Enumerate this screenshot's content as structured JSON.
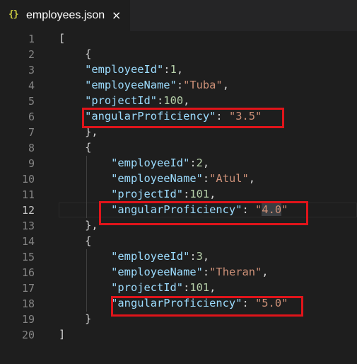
{
  "tab": {
    "icon": "{}",
    "label": "employees.json",
    "close": "×"
  },
  "editor": {
    "active_line": 12,
    "lines": [
      {
        "num": "1",
        "tokens": [
          {
            "t": "[",
            "c": "punc"
          }
        ]
      },
      {
        "num": "2",
        "tokens": [
          {
            "t": "    {",
            "c": "punc"
          }
        ]
      },
      {
        "num": "3",
        "tokens": [
          {
            "t": "    ",
            "c": "punc"
          },
          {
            "t": "\"employeeId\"",
            "c": "key"
          },
          {
            "t": ":",
            "c": "punc"
          },
          {
            "t": "1",
            "c": "num"
          },
          {
            "t": ",",
            "c": "punc"
          }
        ]
      },
      {
        "num": "4",
        "tokens": [
          {
            "t": "    ",
            "c": "punc"
          },
          {
            "t": "\"employeeName\"",
            "c": "key"
          },
          {
            "t": ":",
            "c": "punc"
          },
          {
            "t": "\"Tuba\"",
            "c": "str"
          },
          {
            "t": ",",
            "c": "punc"
          }
        ]
      },
      {
        "num": "5",
        "tokens": [
          {
            "t": "    ",
            "c": "punc"
          },
          {
            "t": "\"projectId\"",
            "c": "key"
          },
          {
            "t": ":",
            "c": "punc"
          },
          {
            "t": "100",
            "c": "num"
          },
          {
            "t": ",",
            "c": "punc"
          }
        ]
      },
      {
        "num": "6",
        "tokens": [
          {
            "t": "    ",
            "c": "punc"
          },
          {
            "t": "\"angularProficiency\"",
            "c": "key"
          },
          {
            "t": ": ",
            "c": "punc"
          },
          {
            "t": "\"3.5\"",
            "c": "str"
          }
        ]
      },
      {
        "num": "7",
        "tokens": [
          {
            "t": "    },",
            "c": "punc"
          }
        ]
      },
      {
        "num": "8",
        "tokens": [
          {
            "t": "    {",
            "c": "punc"
          }
        ]
      },
      {
        "num": "9",
        "tokens": [
          {
            "t": "        ",
            "c": "punc"
          },
          {
            "t": "\"employeeId\"",
            "c": "key"
          },
          {
            "t": ":",
            "c": "punc"
          },
          {
            "t": "2",
            "c": "num"
          },
          {
            "t": ",",
            "c": "punc"
          }
        ]
      },
      {
        "num": "10",
        "tokens": [
          {
            "t": "        ",
            "c": "punc"
          },
          {
            "t": "\"employeeName\"",
            "c": "key"
          },
          {
            "t": ":",
            "c": "punc"
          },
          {
            "t": "\"Atul\"",
            "c": "str"
          },
          {
            "t": ",",
            "c": "punc"
          }
        ]
      },
      {
        "num": "11",
        "tokens": [
          {
            "t": "        ",
            "c": "punc"
          },
          {
            "t": "\"projectId\"",
            "c": "key"
          },
          {
            "t": ":",
            "c": "punc"
          },
          {
            "t": "101",
            "c": "num"
          },
          {
            "t": ",",
            "c": "punc"
          }
        ]
      },
      {
        "num": "12",
        "tokens": [
          {
            "t": "        ",
            "c": "punc"
          },
          {
            "t": "\"angularProficiency\"",
            "c": "key"
          },
          {
            "t": ": ",
            "c": "punc"
          },
          {
            "t": "\"",
            "c": "str"
          },
          {
            "t": "4.0",
            "c": "str",
            "hl": true
          },
          {
            "t": "\"",
            "c": "str"
          }
        ]
      },
      {
        "num": "13",
        "tokens": [
          {
            "t": "    },",
            "c": "punc"
          }
        ]
      },
      {
        "num": "14",
        "tokens": [
          {
            "t": "    {",
            "c": "punc"
          }
        ]
      },
      {
        "num": "15",
        "tokens": [
          {
            "t": "        ",
            "c": "punc"
          },
          {
            "t": "\"employeeId\"",
            "c": "key"
          },
          {
            "t": ":",
            "c": "punc"
          },
          {
            "t": "3",
            "c": "num"
          },
          {
            "t": ",",
            "c": "punc"
          }
        ]
      },
      {
        "num": "16",
        "tokens": [
          {
            "t": "        ",
            "c": "punc"
          },
          {
            "t": "\"employeeName\"",
            "c": "key"
          },
          {
            "t": ":",
            "c": "punc"
          },
          {
            "t": "\"Theran\"",
            "c": "str"
          },
          {
            "t": ",",
            "c": "punc"
          }
        ]
      },
      {
        "num": "17",
        "tokens": [
          {
            "t": "        ",
            "c": "punc"
          },
          {
            "t": "\"projectId\"",
            "c": "key"
          },
          {
            "t": ":",
            "c": "punc"
          },
          {
            "t": "101",
            "c": "num"
          },
          {
            "t": ",",
            "c": "punc"
          }
        ]
      },
      {
        "num": "18",
        "tokens": [
          {
            "t": "        ",
            "c": "punc"
          },
          {
            "t": "\"angularProficiency\"",
            "c": "key"
          },
          {
            "t": ": ",
            "c": "punc"
          },
          {
            "t": "\"5.0\"",
            "c": "str"
          }
        ]
      },
      {
        "num": "19",
        "tokens": [
          {
            "t": "    }",
            "c": "punc"
          }
        ]
      },
      {
        "num": "20",
        "tokens": [
          {
            "t": "]",
            "c": "punc"
          }
        ]
      }
    ]
  },
  "colors": {
    "background": "#1e1e1e",
    "key": "#9cdcfe",
    "string": "#ce9178",
    "number": "#b5cea8",
    "punctuation": "#d4d4d4",
    "line_number": "#858585",
    "annotation_box": "#e0141a",
    "json_icon": "#cbcb41"
  }
}
